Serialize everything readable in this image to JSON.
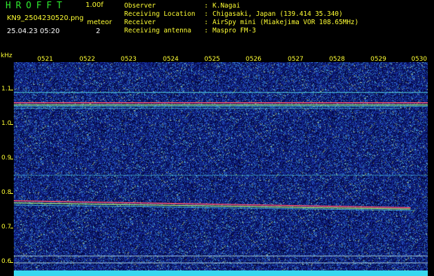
{
  "header": {
    "app_name": "HROFFT",
    "version": "1.00f",
    "filename": "KN9_2504230520.png",
    "timestamp": "25.04.23 05:20",
    "meteor_label": "meteor",
    "meteor_count": "2"
  },
  "info": [
    {
      "label": "Observer",
      "value": "K.Nagai"
    },
    {
      "label": "Receiving Location",
      "value": "Chigasaki, Japan (139.414 35.340)"
    },
    {
      "label": "Receiver",
      "value": "AirSpy mini (Miakejima VOR 108.65MHz)"
    },
    {
      "label": "Receiving antenna",
      "value": "Maspro FM-3"
    }
  ],
  "axes": {
    "y_unit": "kHz",
    "y_ticks": [
      "1.1",
      "1.0",
      "0.9",
      "0.8",
      "0.7",
      "0.6"
    ],
    "x_ticks": [
      "0521",
      "0522",
      "0523",
      "0524",
      "0525",
      "0526",
      "0527",
      "0528",
      "0529",
      "0530"
    ]
  },
  "colors": {
    "background": "#000000",
    "noise_base": "#0a1a6e",
    "label_yellow": "#ffff33",
    "title_green": "#2ee82e",
    "line_cyan": "#4fd0e0"
  }
}
